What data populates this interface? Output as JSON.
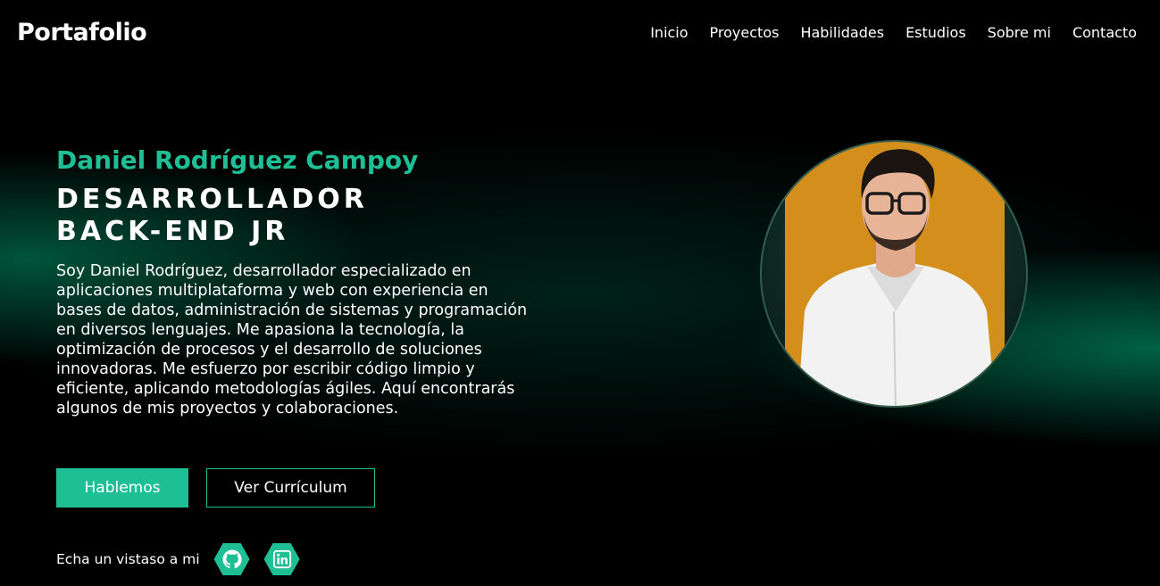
{
  "header": {
    "logo": "Portafolio",
    "nav": [
      "Inicio",
      "Proyectos",
      "Habilidades",
      "Estudios",
      "Sobre mi",
      "Contacto"
    ]
  },
  "hero": {
    "name": "Daniel Rodríguez Campoy",
    "role_line1": "DESARROLLADOR",
    "role_line2": "BACK-END JR",
    "bio": "Soy Daniel Rodríguez, desarrollador especializado en aplicaciones multiplataforma y web con experiencia en bases de datos, administración de sistemas y programación en diversos lenguajes. Me apasiona la tecnología, la optimización de procesos y el desarrollo de soluciones innovadoras. Me esfuerzo por escribir código limpio y eficiente, aplicando metodologías ágiles. Aquí encontrarás algunos de mis proyectos y colaboraciones.",
    "primary_button": "Hablemos",
    "secondary_button": "Ver Currículum"
  },
  "social": {
    "label": "Echa un vistaso a mi",
    "icons": [
      "github-icon",
      "linkedin-icon"
    ]
  },
  "colors": {
    "accent": "#1fbf96",
    "background": "#000000",
    "photo_background": "#d48e1c"
  }
}
